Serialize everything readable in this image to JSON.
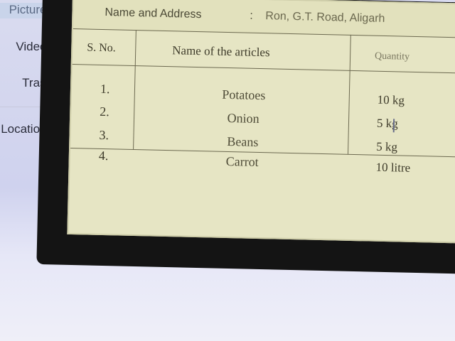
{
  "sidebar": {
    "items": [
      {
        "label": "Pictures"
      },
      {
        "label": "Videos"
      },
      {
        "label": "Trash"
      },
      {
        "label": "Other Locations"
      }
    ]
  },
  "document": {
    "header": {
      "label": "Name and Address",
      "separator": ":",
      "value": "Ron, G.T. Road, Aligarh"
    },
    "table": {
      "columns": [
        "S. No.",
        "Name of the articles",
        "Quantity"
      ],
      "rows": [
        {
          "sno": "1.",
          "name": "Potatoes",
          "qty": "10 kg"
        },
        {
          "sno": "2.",
          "name": "Onion",
          "qty": "5 kg"
        },
        {
          "sno": "3.",
          "name": "Beans",
          "qty": "5 kg"
        },
        {
          "sno": "4.",
          "name": "Carrot",
          "qty": "10 litre"
        }
      ]
    }
  }
}
